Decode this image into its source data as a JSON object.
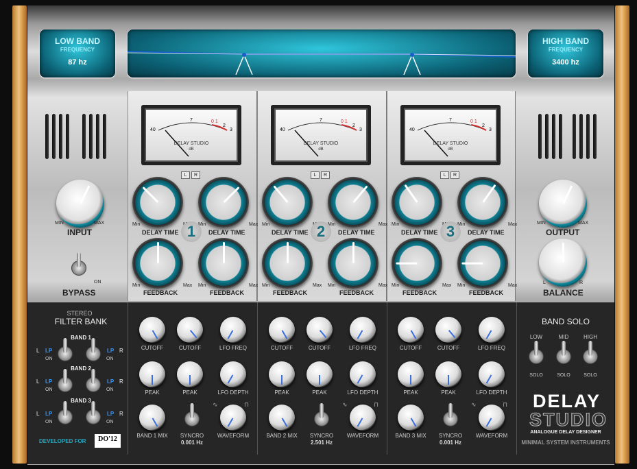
{
  "header": {
    "low_band": {
      "title": "LOW BAND",
      "subtitle": "FREQUENCY",
      "value": "87 hz"
    },
    "high_band": {
      "title": "HIGH BAND",
      "subtitle": "FREQUENCY",
      "value": "3400 hz"
    }
  },
  "vu_meter": {
    "brand": "DELAY STUDIO",
    "unit": "dB",
    "scale_left": "40",
    "scale_mid": "7",
    "scale_hot": "0 1",
    "scale_right": "2",
    "scale_end": "3"
  },
  "lr": {
    "l": "L",
    "r": "R"
  },
  "input": {
    "label": "INPUT",
    "min": "MIN",
    "max": "MAX"
  },
  "bypass": {
    "label": "BYPASS",
    "on": "ON"
  },
  "output": {
    "label": "OUTPUT",
    "min": "MIN",
    "max": "MAX"
  },
  "balance": {
    "label": "BALANCE",
    "l": "L",
    "r": "R"
  },
  "channels": [
    {
      "number": "1",
      "delay_label": "DELAY TIME",
      "feedback_label": "FEEDBACK",
      "min": "Min",
      "max": "Max"
    },
    {
      "number": "2",
      "delay_label": "DELAY TIME",
      "feedback_label": "FEEDBACK",
      "min": "Min",
      "max": "Max"
    },
    {
      "number": "3",
      "delay_label": "DELAY TIME",
      "feedback_label": "FEEDBACK",
      "min": "Min",
      "max": "Max"
    }
  ],
  "filter_bank": {
    "stereo": "STEREO",
    "title": "FILTER BANK",
    "bands": [
      "BAND 1",
      "BAND 2",
      "BAND 3"
    ],
    "l": "L",
    "r": "R",
    "lp": "LP",
    "on": "ON",
    "developed_for": "DEVELOPED FOR",
    "badge": "DO'12"
  },
  "mod": [
    {
      "cutoff": "CUTOFF",
      "peak": "PEAK",
      "lfo_freq": "LFO FREQ",
      "lfo_depth": "LFO DEPTH",
      "band_mix": "BAND 1 MIX",
      "syncro": "SYNCRO",
      "syncro_value": "0.001 Hz",
      "waveform": "WAVEFORM"
    },
    {
      "cutoff": "CUTOFF",
      "peak": "PEAK",
      "lfo_freq": "LFO FREQ",
      "lfo_depth": "LFO DEPTH",
      "band_mix": "BAND 2 MIX",
      "syncro": "SYNCRO",
      "syncro_value": "2.501 Hz",
      "waveform": "WAVEFORM"
    },
    {
      "cutoff": "CUTOFF",
      "peak": "PEAK",
      "lfo_freq": "LFO FREQ",
      "lfo_depth": "LFO DEPTH",
      "band_mix": "BAND 3 MIX",
      "syncro": "SYNCRO",
      "syncro_value": "0.001 Hz",
      "waveform": "WAVEFORM"
    }
  ],
  "band_solo": {
    "title": "BAND SOLO",
    "low": "LOW",
    "mid": "MID",
    "high": "HIGH",
    "solo": "SOLO"
  },
  "logo": {
    "line1": "DELAY",
    "line2": "STUDIO",
    "tagline": "ANALOGUE DELAY DESIGNER",
    "company": "MINIMAL SYSTEM INSTRUMENTS"
  },
  "colors": {
    "accent": "#0f8ea3",
    "lcd_text": "#d6fbff",
    "knob_pointer": "#3a6fe0"
  }
}
